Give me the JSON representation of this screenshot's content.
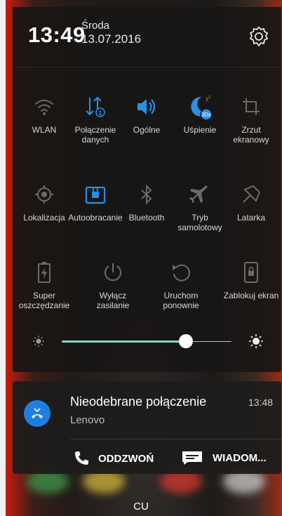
{
  "header": {
    "time": "13:49",
    "day": "Środa",
    "date": "13.07.2016"
  },
  "tiles": [
    {
      "label": "WLAN",
      "icon": "wifi-icon",
      "active": false
    },
    {
      "label": "Połączenie danych",
      "icon": "data-connection-icon",
      "active": true
    },
    {
      "label": "Ogólne",
      "icon": "volume-icon",
      "active": true
    },
    {
      "label": "Uśpienie",
      "icon": "sleep-icon",
      "active": true,
      "badge": "30s"
    },
    {
      "label": "Zrzut ekranowy",
      "icon": "crop-icon",
      "active": false
    },
    {
      "label": "Lokalizacja",
      "icon": "location-icon",
      "active": false
    },
    {
      "label": "Autoobracanie",
      "icon": "auto-rotate-icon",
      "active": true
    },
    {
      "label": "Bluetooth",
      "icon": "bluetooth-icon",
      "active": false
    },
    {
      "label": "Tryb samolotowy",
      "icon": "airplane-icon",
      "active": false
    },
    {
      "label": "Latarka",
      "icon": "flashlight-icon",
      "active": false
    },
    {
      "label": "Super oszczędzanie",
      "icon": "battery-saver-icon",
      "active": false
    },
    {
      "label": "Wyłącz zasilanie",
      "icon": "power-icon",
      "active": false
    },
    {
      "label": "Uruchom ponownie",
      "icon": "restart-icon",
      "active": false
    },
    {
      "label": "Zablokuj ekran",
      "icon": "lock-screen-icon",
      "active": false
    }
  ],
  "brightness": {
    "level": 0.73,
    "accent": "#7ed9cc"
  },
  "notification": {
    "title": "Nieodebrane połączenie",
    "subtitle": "Lenovo",
    "time": "13:48",
    "actions": [
      {
        "label": "ODDZWOŃ",
        "icon": "phone-icon"
      },
      {
        "label": "WIADOM...",
        "icon": "message-icon"
      }
    ]
  },
  "carrier": "CU",
  "colors": {
    "active": "#2a8fe8",
    "inactive": "#6b6b6b"
  }
}
